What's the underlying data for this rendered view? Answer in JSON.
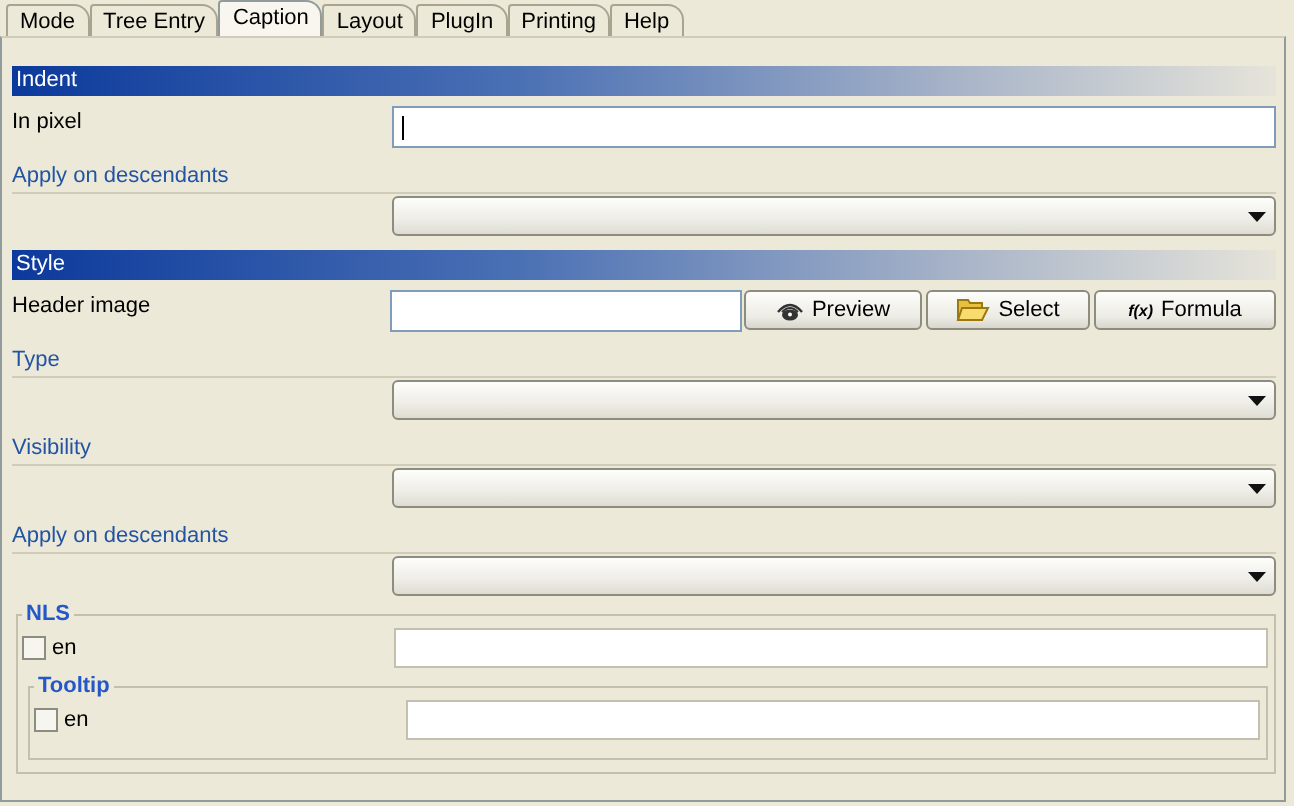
{
  "tabs": [
    {
      "label": "Mode",
      "selected": false
    },
    {
      "label": "Tree Entry",
      "selected": false
    },
    {
      "label": "Caption",
      "selected": true
    },
    {
      "label": "Layout",
      "selected": false
    },
    {
      "label": "PlugIn",
      "selected": false
    },
    {
      "label": "Printing",
      "selected": false
    },
    {
      "label": "Help",
      "selected": false
    }
  ],
  "sections": [
    {
      "title": "Indent",
      "rows": [
        {
          "kind": "text",
          "label": "In pixel",
          "focused": true
        },
        {
          "kind": "dropdown",
          "label": "Apply on descendants"
        }
      ]
    },
    {
      "title": "Style",
      "rows": [
        {
          "kind": "image",
          "label": "Header image",
          "buttons": [
            {
              "kind": "eye",
              "label": "Preview"
            },
            {
              "kind": "folder",
              "label": "Select"
            },
            {
              "kind": "function",
              "symbol": "f(x)",
              "label": "Formula"
            }
          ]
        },
        {
          "kind": "dropdown",
          "label": "Type"
        },
        {
          "kind": "dropdown",
          "label": "Visibility"
        },
        {
          "kind": "dropdown",
          "label": "Apply on descendants"
        }
      ]
    }
  ],
  "nls": {
    "legend": "NLS",
    "entries": [
      {
        "label": "en",
        "checked": false
      }
    ],
    "tooltip": {
      "legend": "Tooltip",
      "entries": [
        {
          "label": "en",
          "checked": false
        }
      ]
    }
  }
}
